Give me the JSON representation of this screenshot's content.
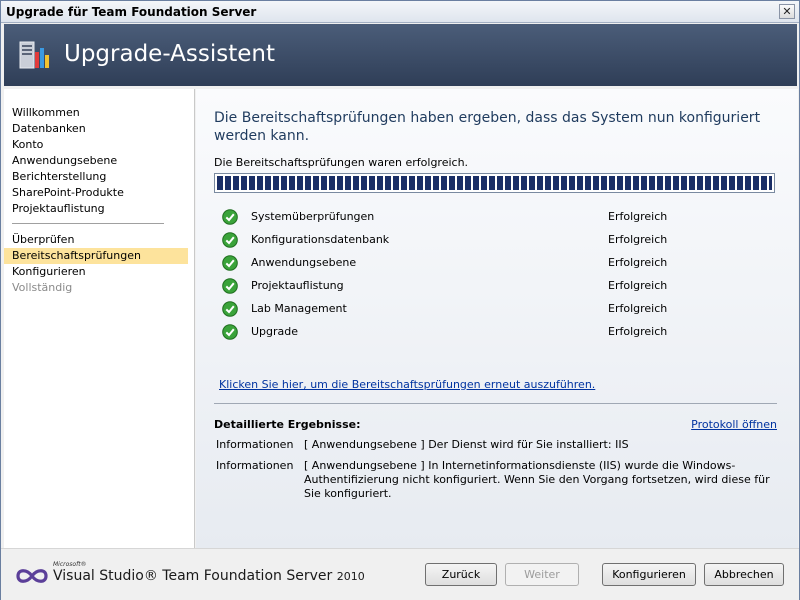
{
  "window": {
    "title": "Upgrade für Team Foundation Server",
    "close_glyph": "✕"
  },
  "banner": {
    "heading": "Upgrade-Assistent",
    "icon": "server-wizard-icon"
  },
  "sidebar": {
    "items_top": [
      {
        "label": "Willkommen"
      },
      {
        "label": "Datenbanken"
      },
      {
        "label": "Konto"
      },
      {
        "label": "Anwendungsebene"
      },
      {
        "label": "Berichterstellung"
      },
      {
        "label": "SharePoint-Produkte"
      },
      {
        "label": "Projektauflistung"
      }
    ],
    "items_bottom": [
      {
        "label": "Überprüfen"
      },
      {
        "label": "Bereitschaftsprüfungen",
        "active": true
      },
      {
        "label": "Konfigurieren"
      },
      {
        "label": "Vollständig",
        "disabled": true
      }
    ]
  },
  "main": {
    "heading": "Die Bereitschaftsprüfungen haben ergeben, dass das System nun konfiguriert werden kann.",
    "status": "Die Bereitschaftsprüfungen waren erfolgreich.",
    "progress": 1.0,
    "checks": [
      {
        "label": "Systemüberprüfungen",
        "result": "Erfolgreich"
      },
      {
        "label": "Konfigurationsdatenbank",
        "result": "Erfolgreich"
      },
      {
        "label": "Anwendungsebene",
        "result": "Erfolgreich"
      },
      {
        "label": "Projektauflistung",
        "result": "Erfolgreich"
      },
      {
        "label": "Lab Management",
        "result": "Erfolgreich"
      },
      {
        "label": "Upgrade",
        "result": "Erfolgreich"
      }
    ],
    "rerun_link": "Klicken Sie hier, um die Bereitschaftsprüfungen erneut auszuführen.",
    "details_title": "Detaillierte Ergebnisse:",
    "log_link": "Protokoll öffnen",
    "details": [
      {
        "type": "Informationen",
        "message": "[ Anwendungsebene ] Der Dienst wird für Sie installiert: IIS"
      },
      {
        "type": "Informationen",
        "message": "[ Anwendungsebene ] In Internetinformationsdienste (IIS) wurde die Windows-Authentifizierung nicht konfiguriert. Wenn Sie den Vorgang fortsetzen, wird diese für Sie konfiguriert."
      }
    ]
  },
  "footer": {
    "logo": {
      "ms": "Microsoft®",
      "product": "Visual Studio® Team Foundation Server",
      "year": "2010"
    },
    "buttons": {
      "back": "Zurück",
      "next": "Weiter",
      "configure": "Konfigurieren",
      "cancel": "Abbrechen"
    }
  },
  "colors": {
    "banner": "#3a4a66",
    "active_nav": "#fde39c",
    "progress": "#1a2e66",
    "link": "#0033a0"
  }
}
